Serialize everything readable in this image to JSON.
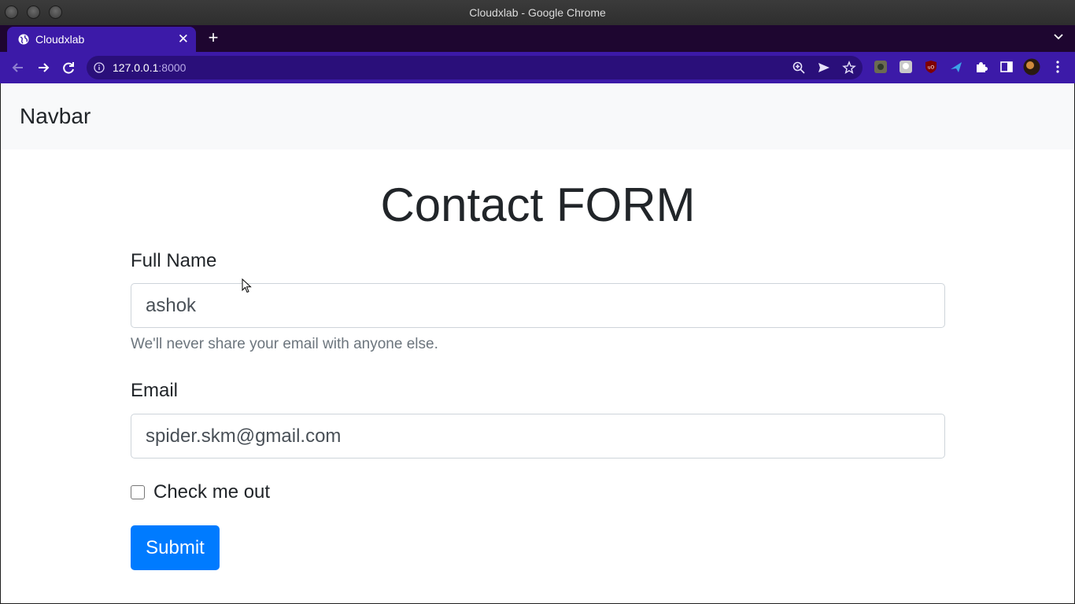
{
  "window": {
    "title": "Cloudxlab - Google Chrome"
  },
  "tabs": [
    {
      "label": "Cloudxlab",
      "icon": "globe-icon",
      "active": true
    }
  ],
  "toolbar": {
    "url_host": "127.0.0.1",
    "url_port": ":8000"
  },
  "page": {
    "navbar_brand": "Navbar",
    "heading": "Contact FORM",
    "full_name": {
      "label": "Full Name",
      "value": "ashok",
      "help": "We'll never share your email with anyone else."
    },
    "email": {
      "label": "Email",
      "value": "spider.skm@gmail.com"
    },
    "checkbox": {
      "label": "Check me out",
      "checked": false
    },
    "submit_label": "Submit"
  },
  "colors": {
    "tab_bar": "#1e0630",
    "toolbar": "#3c1aa8",
    "primary": "#007bff",
    "navbar_bg": "#f8f9fa"
  }
}
